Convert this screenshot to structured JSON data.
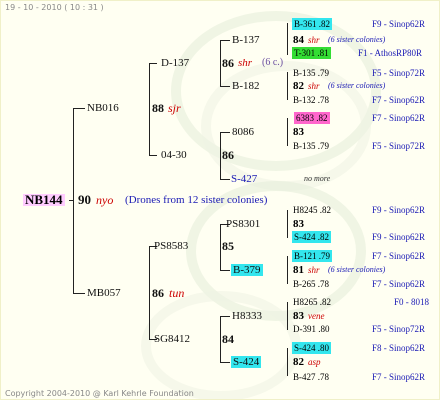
{
  "timestamp": "19 - 10 - 2010 ( 10 : 31 )",
  "copyright": "Copyright 2004-2010 @ Karl Kehrle Foundation",
  "root": {
    "name": "NB144",
    "num": "90",
    "code": "nyo",
    "note": "(Drones from 12 sister colonies)"
  },
  "lvl1": [
    {
      "name": "NB016",
      "num": "88",
      "code": "sjr"
    },
    {
      "name": "MB057",
      "num": "86",
      "code": "tun"
    }
  ],
  "lvl2": [
    {
      "name": "D-137",
      "num": "86",
      "code": "shr",
      "note": "(6 c.)"
    },
    {
      "name": "04-30",
      "num": "86",
      "code": "",
      "note": ""
    },
    {
      "name": "PS8583",
      "num": "85",
      "code": "",
      "note": ""
    },
    {
      "name": "SG8412",
      "num": "84",
      "code": "",
      "note": ""
    }
  ],
  "lvl3": [
    {
      "name": "B-137"
    },
    {
      "name": "B-182"
    },
    {
      "name": "8086"
    },
    {
      "name": "S-427"
    },
    {
      "name": "PS8301"
    },
    {
      "name": "B-379"
    },
    {
      "name": "H8333"
    },
    {
      "name": "S-424"
    }
  ],
  "rows": [
    {
      "left": "B-361 .82",
      "right": "F9 - Sinop62R"
    },
    {
      "left": "84",
      "code": "shr",
      "note": "(6 sister colonies)"
    },
    {
      "left": "T-301 .81",
      "right": "F1 - AthosRP80R"
    },
    {
      "left": "B-135 .79",
      "right": "F5 - Sinop72R"
    },
    {
      "left": "82",
      "code": "shr",
      "note": "(6 sister colonies)"
    },
    {
      "left": "B-132 .78",
      "right": "F7 - Sinop62R"
    },
    {
      "left": "6383 .82",
      "right": "F7 - Sinop62R"
    },
    {
      "left": "83"
    },
    {
      "left": "B-135 .79",
      "right": "F5 - Sinop72R"
    },
    {
      "left": "no more"
    },
    {
      "left": "H8245 .82",
      "right": "F9 - Sinop62R"
    },
    {
      "left": "83"
    },
    {
      "left": "S-424 .82",
      "right": "F9 - Sinop62R"
    },
    {
      "left": "B-121 .79",
      "right": "F7 - Sinop62R"
    },
    {
      "left": "81",
      "code": "shr",
      "note": "(6 sister colonies)"
    },
    {
      "left": "B-265 .78",
      "right": "F7 - Sinop62R"
    },
    {
      "left": "H8265 .82",
      "right": "F0 - 8018"
    },
    {
      "left": "83",
      "code": "vene"
    },
    {
      "left": "D-391 .80",
      "right": "F5 - Sinop72R"
    },
    {
      "left": "S-424 .80",
      "right": "F8 - Sinop62R"
    },
    {
      "left": "82",
      "code": "asp"
    },
    {
      "left": "B-427 .78",
      "right": "F7 - Sinop62R"
    }
  ]
}
